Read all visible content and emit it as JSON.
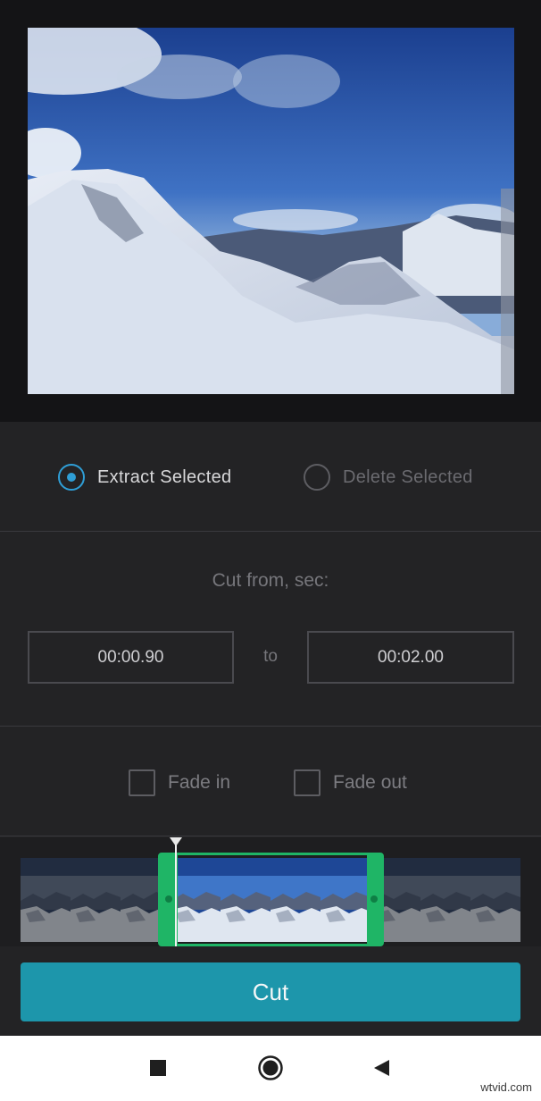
{
  "mode": {
    "extract_label": "Extract Selected",
    "delete_label": "Delete Selected",
    "selected": "extract"
  },
  "time_range": {
    "label": "Cut from, sec:",
    "from": "00:00.90",
    "to_label": "to",
    "to": "00:02.00"
  },
  "fades": {
    "fade_in_label": "Fade in",
    "fade_in_checked": false,
    "fade_out_label": "Fade out",
    "fade_out_checked": false
  },
  "cut_button_label": "Cut",
  "colors": {
    "accent_radio": "#2f9ed6",
    "selection_handle": "#1fb566",
    "cut_button": "#1d96ab"
  },
  "nav": {
    "recent_icon": "square-recents-icon",
    "home_icon": "circle-home-icon",
    "back_icon": "triangle-back-icon"
  },
  "watermark": "wtvid.com"
}
